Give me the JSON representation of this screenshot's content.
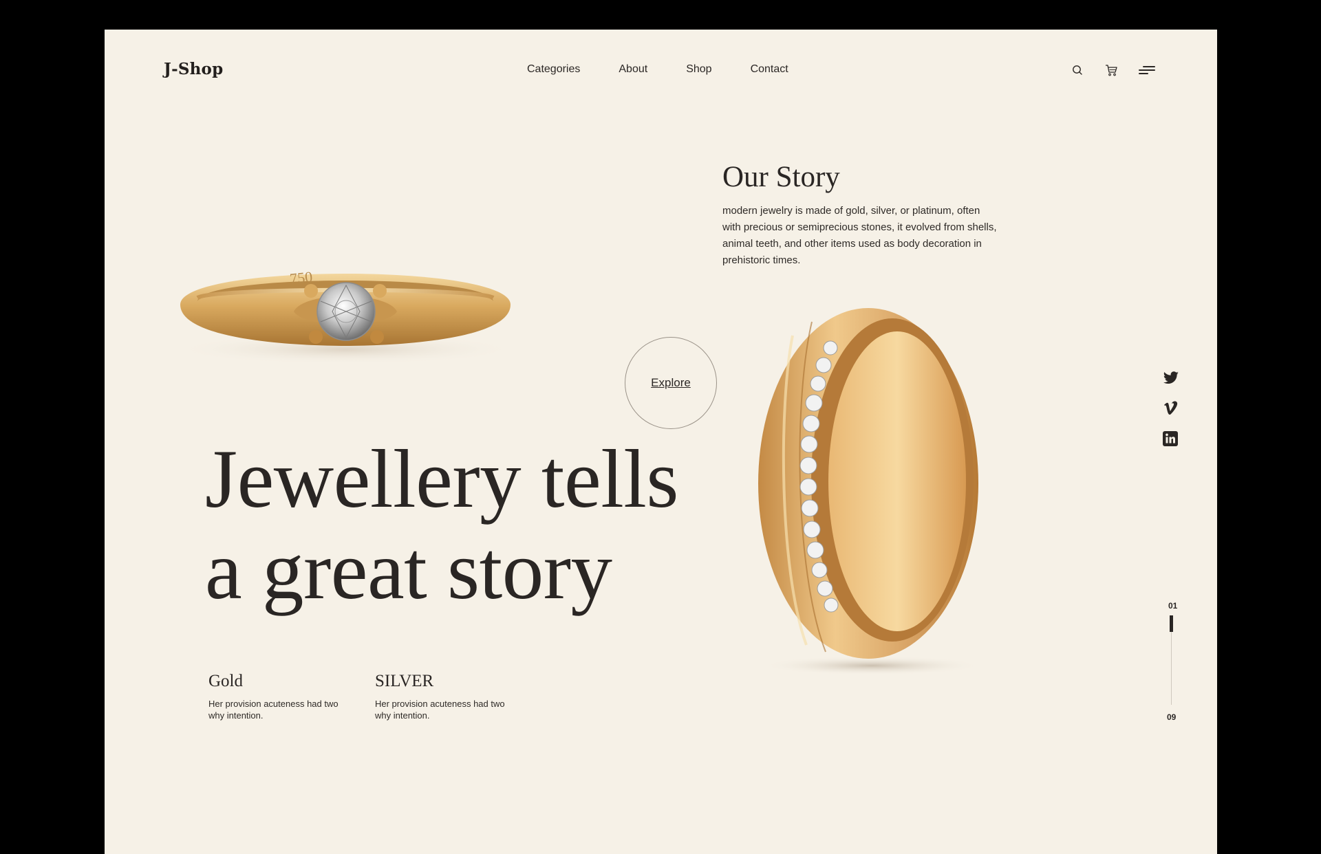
{
  "header": {
    "logo": "J-Shop",
    "nav": [
      "Categories",
      "About",
      "Shop",
      "Contact"
    ],
    "icons": [
      "search-icon",
      "cart-icon",
      "menu-icon"
    ]
  },
  "story": {
    "title": "Our Story",
    "text": "modern jewelry is made of gold, silver, or platinum, often with precious or semiprecious stones, it evolved from shells, animal teeth, and other items used as body decoration in prehistoric times."
  },
  "explore_label": "Explore",
  "hero": {
    "line1": "Jewellery tells",
    "line2": "a great story"
  },
  "materials": [
    {
      "title": "Gold",
      "text": "Her provision acuteness had two why intention."
    },
    {
      "title": "SILVER",
      "text": "Her provision acuteness had two why intention."
    }
  ],
  "images": {
    "ring_engraving": "750"
  },
  "social": [
    "twitter-icon",
    "vimeo-icon",
    "linkedin-icon"
  ],
  "pager": {
    "current": "01",
    "total": "09"
  },
  "colors": {
    "background": "#f6f1e7",
    "text": "#2a2624",
    "gold": "#d4a45e"
  }
}
